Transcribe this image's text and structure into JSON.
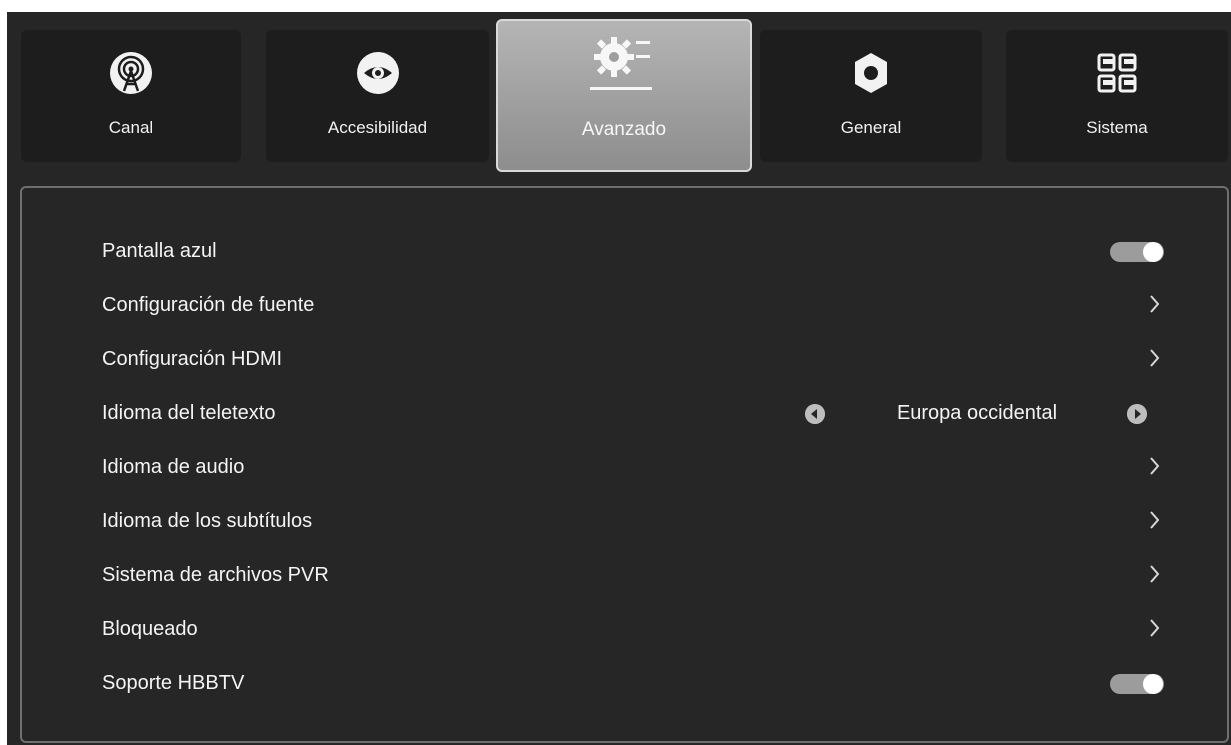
{
  "tabs": [
    {
      "label": "Canal",
      "icon": "antenna-icon"
    },
    {
      "label": "Accesibilidad",
      "icon": "eye-icon"
    },
    {
      "label": "Avanzado",
      "icon": "advanced-settings-icon",
      "active": true
    },
    {
      "label": "General",
      "icon": "gear-icon"
    },
    {
      "label": "Sistema",
      "icon": "grid-icon"
    }
  ],
  "settings": {
    "rows": [
      {
        "label": "Pantalla azul",
        "control": "toggle",
        "on": true
      },
      {
        "label": "Configuración de fuente",
        "control": "chevron"
      },
      {
        "label": "Configuración HDMI",
        "control": "chevron"
      },
      {
        "label": "Idioma del teletexto",
        "control": "selector",
        "value": "Europa occidental"
      },
      {
        "label": "Idioma de audio",
        "control": "chevron"
      },
      {
        "label": "Idioma de los subtítulos",
        "control": "chevron"
      },
      {
        "label": "Sistema de archivos PVR",
        "control": "chevron"
      },
      {
        "label": "Bloqueado",
        "control": "chevron"
      },
      {
        "label": "Soporte HBBTV",
        "control": "toggle",
        "on": true
      }
    ]
  },
  "colors": {
    "background": "#262626",
    "tab_background": "#1d1d1d",
    "active_tab": "#a3a3a3",
    "text": "#f4f4f4"
  }
}
